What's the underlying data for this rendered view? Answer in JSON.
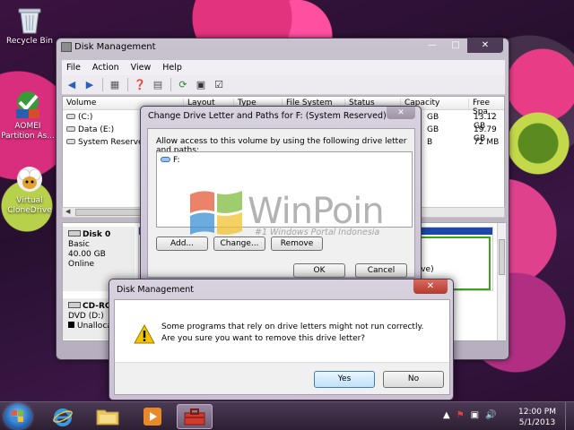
{
  "desktop": {
    "icons": [
      {
        "label": "Recycle Bin"
      },
      {
        "label": "AOMEI Partition As..."
      },
      {
        "label": "Virtual CloneDrive"
      }
    ]
  },
  "main_window": {
    "title": "Disk Management",
    "menu": [
      "File",
      "Action",
      "View",
      "Help"
    ],
    "columns": [
      "Volume",
      "Layout",
      "Type",
      "File System",
      "Status",
      "Capacity",
      "Free Spa..."
    ],
    "volumes": [
      {
        "name": "(C:)",
        "capacity": "GB",
        "free": "13.12 GB"
      },
      {
        "name": "Data (E:)",
        "capacity": "GB",
        "free": "19.79 GB"
      },
      {
        "name": "System Reserved (",
        "capacity": "B",
        "free": "72 MB"
      }
    ],
    "disk0": {
      "name": "Disk 0",
      "type": "Basic",
      "size": "40.00 GB",
      "status": "Online",
      "partition_text": "rive)"
    },
    "cdrom": {
      "name": "CD-RO",
      "drive": "DVD (D:)",
      "status": "Unalloca"
    }
  },
  "change_dialog": {
    "title": "Change Drive Letter and Paths for F: (System Reserved)",
    "prompt": "Allow access to this volume by using the following drive letter and paths:",
    "paths": [
      "F:"
    ],
    "buttons": {
      "add": "Add...",
      "change": "Change...",
      "remove": "Remove",
      "ok": "OK",
      "cancel": "Cancel"
    }
  },
  "watermark": {
    "text": "WinPoin",
    "subtitle": "#1 Windows Portal Indonesia"
  },
  "confirm_dialog": {
    "title": "Disk Management",
    "message": "Some programs that rely on drive letters might not run correctly. Are you sure you want to remove this drive letter?",
    "yes": "Yes",
    "no": "No"
  },
  "taskbar": {
    "time": "12:00 PM",
    "date": "5/1/2013"
  },
  "colors": {
    "accent": "#3ea11f",
    "partition_bar": "#1d47a8",
    "close_red": "#c2483b"
  }
}
